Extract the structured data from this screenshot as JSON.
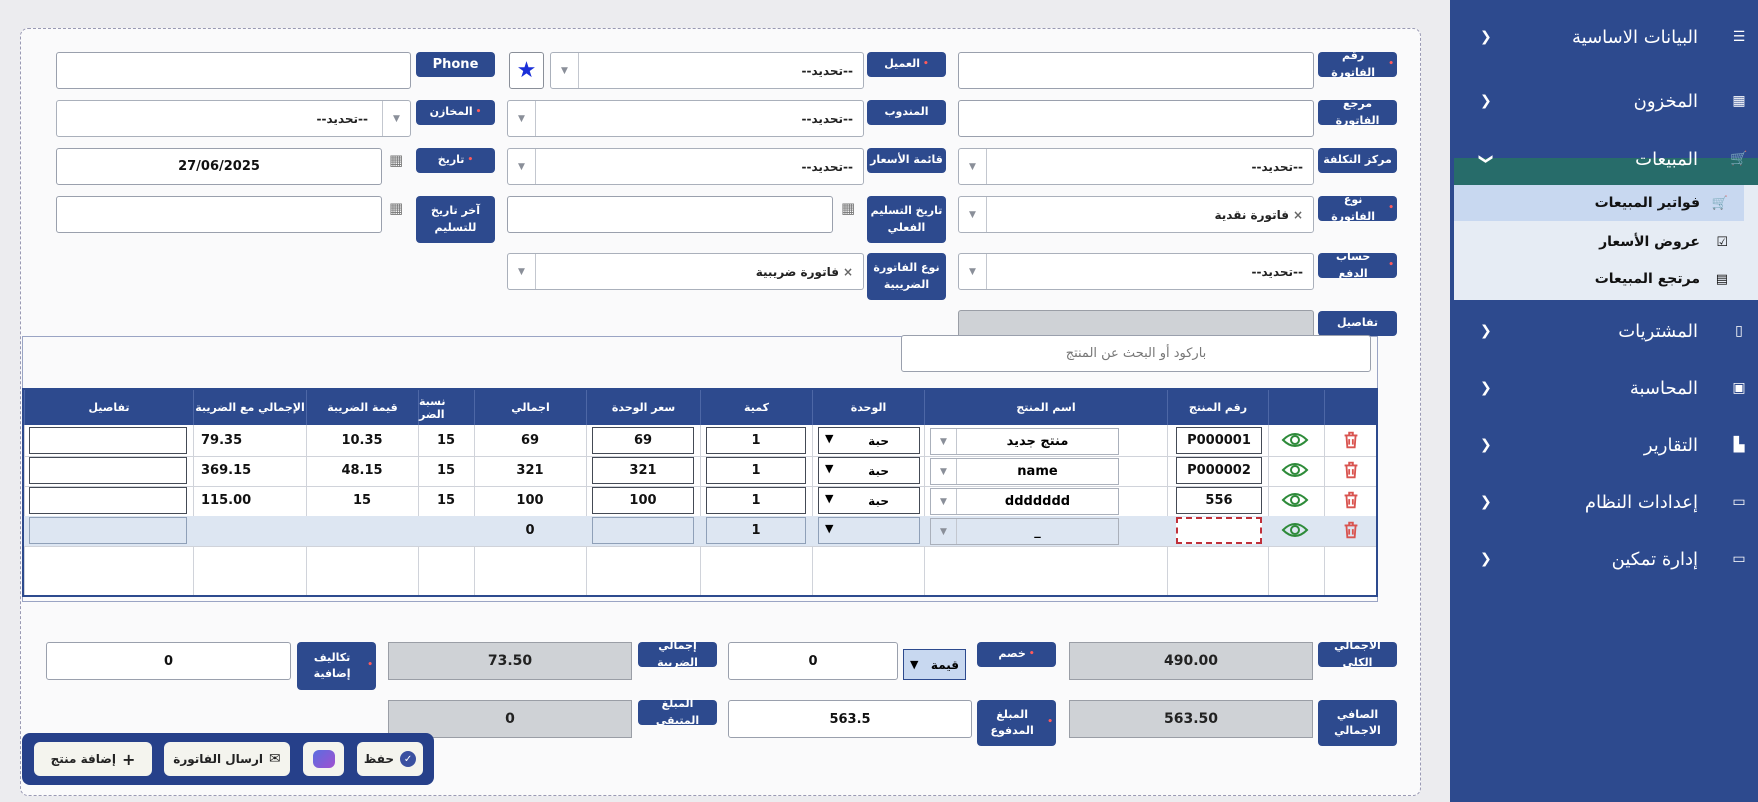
{
  "form": {
    "invoice_no_label": "رقم الفاتورة",
    "invoice_ref_label": "مرجع الفاتورة",
    "cost_center_label": "مركز التكلفة",
    "invoice_type_label": "نوع الفاتورة",
    "payment_account_label": "حساب الدفع",
    "details_label": "تفاصيل",
    "customer_label": "العميل",
    "delegate_label": "المندوب",
    "price_list_label": "قائمة الأسعار",
    "actual_delivery_label": "تاريخ التسليم الفعلي",
    "tax_invoice_type_label": "نوع الفاتورة الضريبية",
    "phone_label": "Phone",
    "stores_label": "المخازن",
    "date_label": "تاريخ",
    "last_delivery_label": "آخر تاريخ للتسليم",
    "select_placeholder": "--تحديد--",
    "invoice_type_value": "فاتورة نقدية",
    "tax_invoice_type_value": "فاتورة ضريبية",
    "date_value": "27/06/2025",
    "clear_x": "×"
  },
  "search": {
    "placeholder": "باركود أو البحث عن المنتج"
  },
  "table": {
    "headers": [
      "رقم المنتج",
      "اسم المنتج",
      "الوحدة",
      "كمية",
      "سعر الوحدة",
      "اجمالي",
      "نسبة الضر",
      "قيمة الضريبة",
      "الإجمالي مع الضريبة",
      "تفاصيل"
    ],
    "rows": [
      {
        "code": "P000001",
        "name": "منتج جديد",
        "unit": "حبة",
        "qty": "1",
        "price": "69",
        "total": "69",
        "tax_rate": "15",
        "tax": "10.35",
        "total_tax": "79.35"
      },
      {
        "code": "P000002",
        "name": "name",
        "unit": "حبة",
        "qty": "1",
        "price": "321",
        "total": "321",
        "tax_rate": "15",
        "tax": "48.15",
        "total_tax": "369.15"
      },
      {
        "code": "556",
        "name": "ddddddd",
        "unit": "حبة",
        "qty": "1",
        "price": "100",
        "total": "100",
        "tax_rate": "15",
        "tax": "15",
        "total_tax": "115.00"
      }
    ],
    "new_row": {
      "name": "_",
      "qty": "1",
      "total": "0"
    }
  },
  "totals": {
    "grand_total_label": "الاجمالي الكلي",
    "grand_total": "490.00",
    "discount_label": "خصم",
    "discount_type": "قيمة",
    "discount_value": "0",
    "tax_total_label": "إجمالي الضريبة",
    "tax_total": "73.50",
    "extra_costs_label": "تكاليف إضافية",
    "extra_costs": "0",
    "net_total_label": "الصافي الاجمالي",
    "net_total": "563.50",
    "paid_label": "المبلغ المدفوع",
    "paid": "563.5",
    "remaining_label": "المبلغ المتبقي",
    "remaining": "0"
  },
  "actions": {
    "save": "حفظ",
    "send_invoice": "ارسال الفاتورة",
    "add_product": "إضافة منتج"
  },
  "sidebar": {
    "items": [
      {
        "label": "البيانات الاساسية",
        "icon": "list-icon"
      },
      {
        "label": "المخزون",
        "icon": "grid-icon"
      },
      {
        "label": "المبيعات",
        "icon": "cart-icon"
      },
      {
        "label": "المشتريات",
        "icon": "file-icon"
      },
      {
        "label": "المحاسبة",
        "icon": "briefcase-icon"
      },
      {
        "label": "التقارير",
        "icon": "chart-icon"
      },
      {
        "label": "إعدادات النظام",
        "icon": "monitor-icon"
      },
      {
        "label": "إدارة تمكين",
        "icon": "monitor-icon"
      }
    ],
    "sales_sub": [
      {
        "label": "فواتير المبيعات",
        "icon": "cart-icon"
      },
      {
        "label": "عروض الأسعار",
        "icon": "checkbox-icon"
      },
      {
        "label": "مرتجع المبيعات",
        "icon": "id-card-icon"
      }
    ]
  },
  "colors": {
    "primary": "#2d4a8e",
    "danger": "#d9534f",
    "success": "#2e8b3a"
  }
}
